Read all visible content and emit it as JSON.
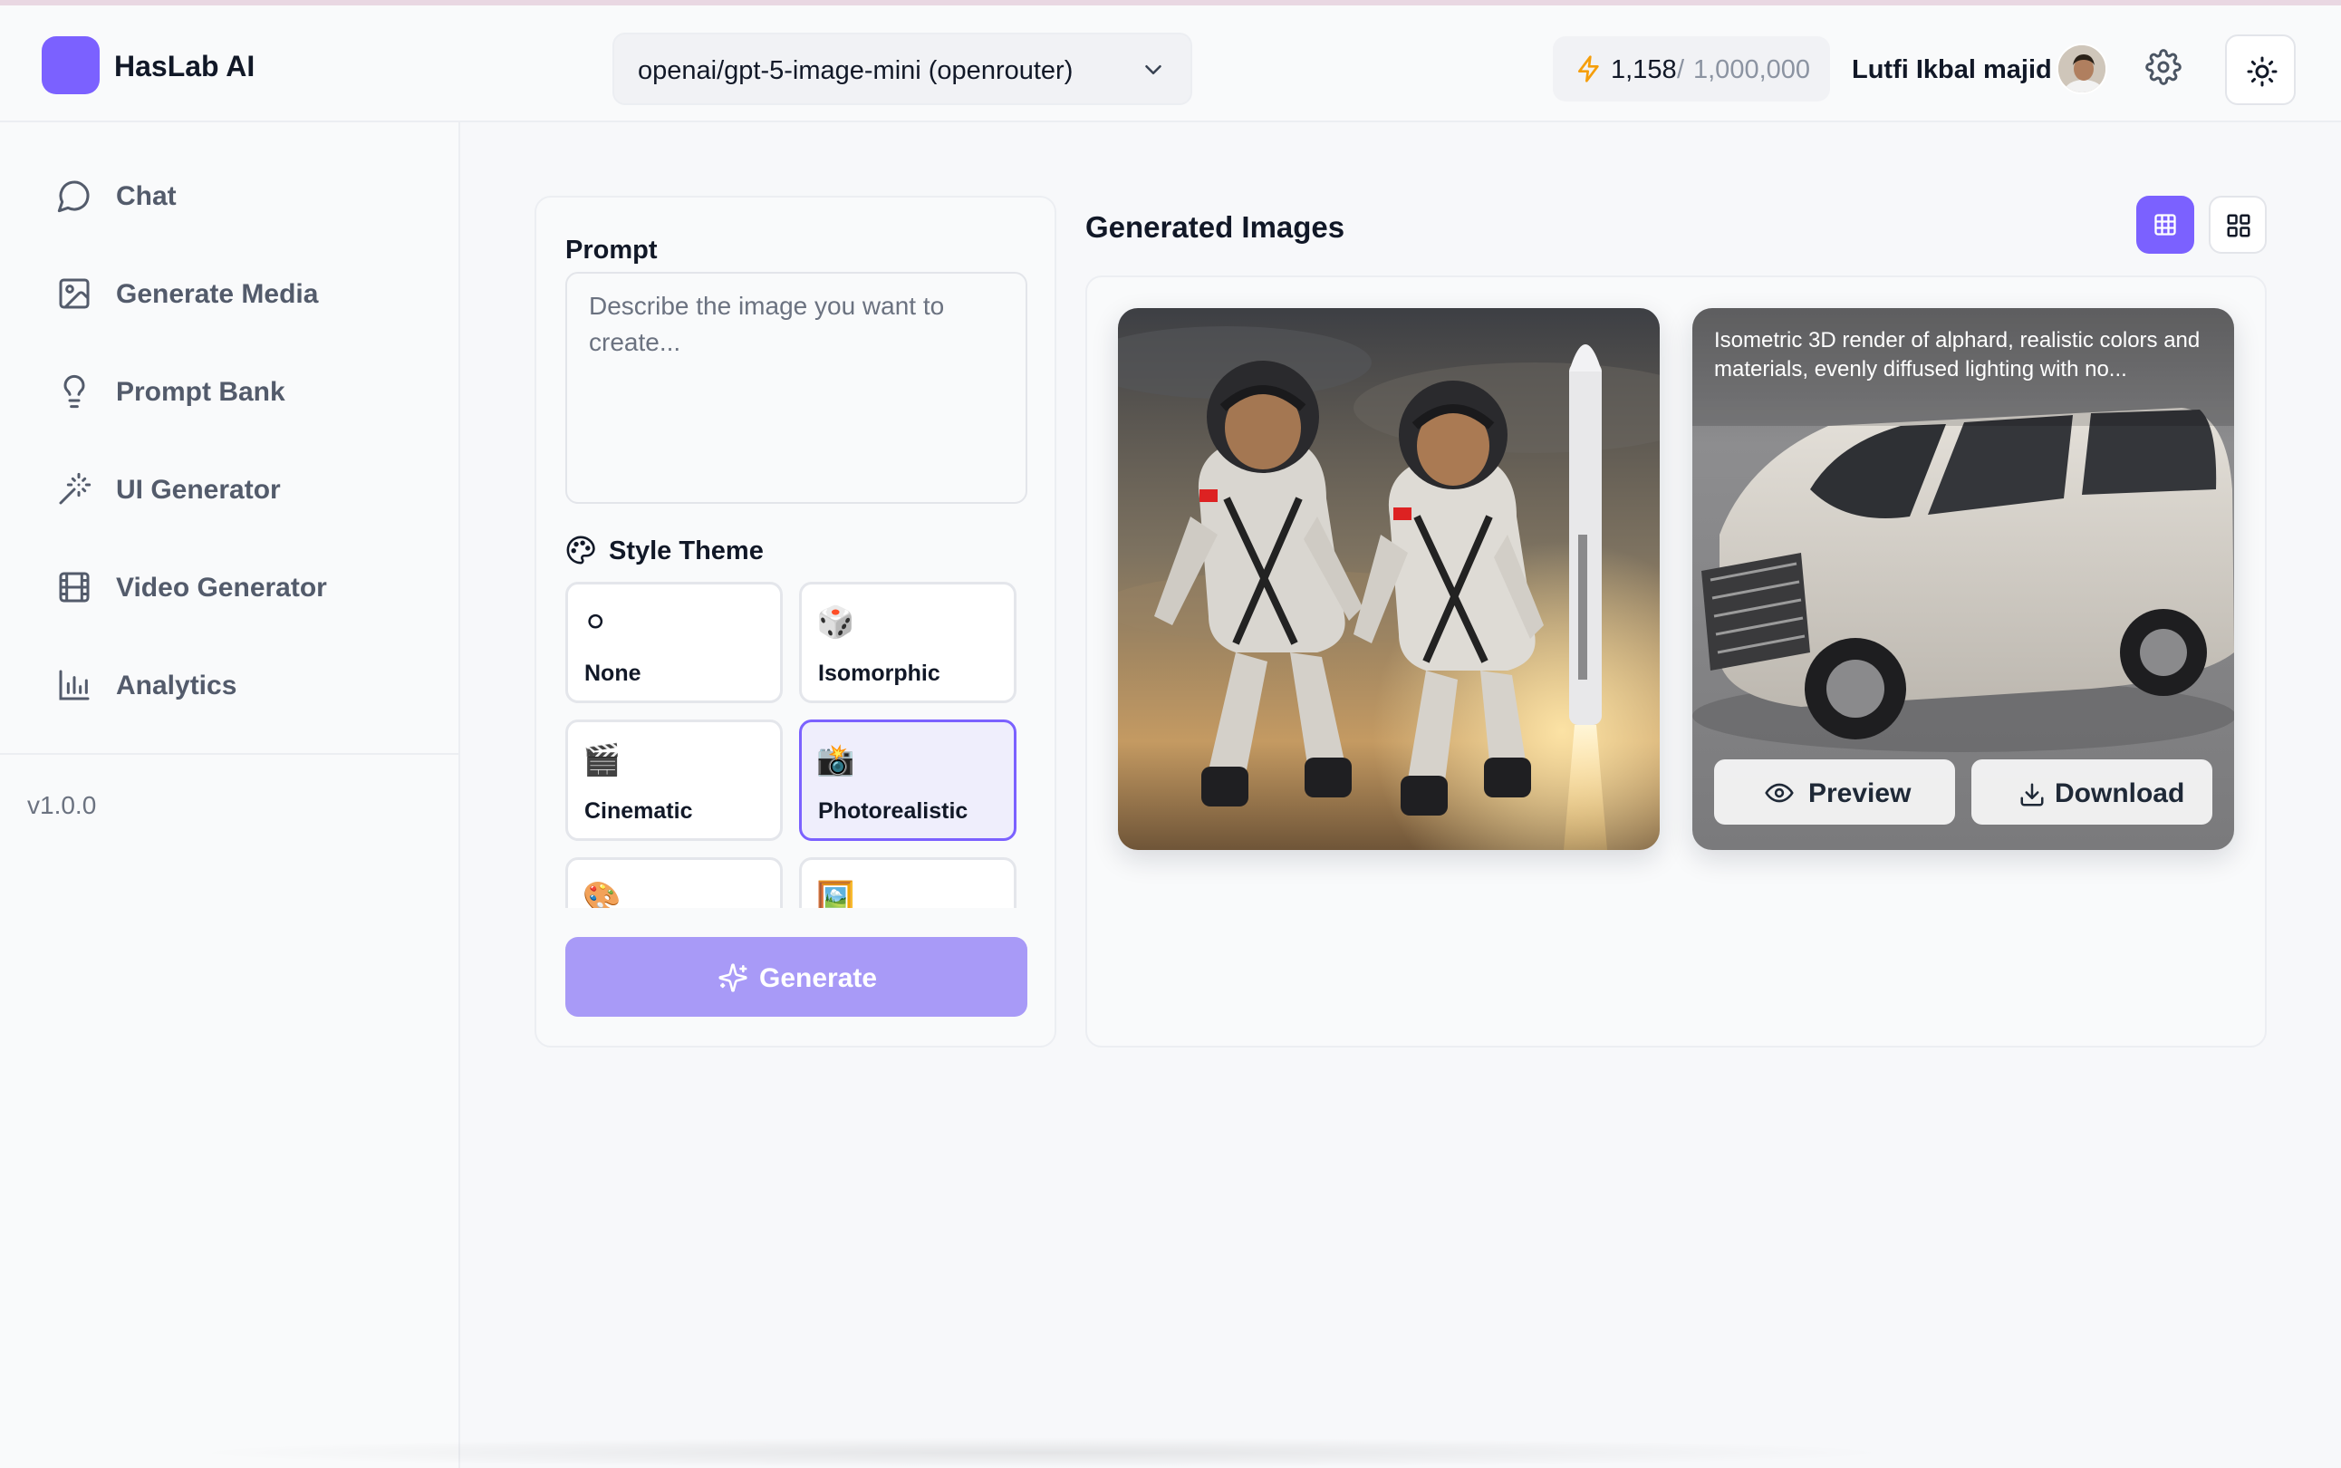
{
  "app": {
    "title": "HasLab AI",
    "brand_color": "#7b61ff"
  },
  "header": {
    "model": {
      "selected": "openai/gpt-5-image-mini (openrouter)"
    },
    "credits": {
      "used": "1,158",
      "separator": "/",
      "limit": "1,000,000",
      "icon": "bolt-icon"
    },
    "user": {
      "name": "Lutfi Ikbal majid"
    },
    "icons": {
      "settings": "gear-icon",
      "theme": "sun-icon"
    }
  },
  "sidebar": {
    "items": [
      {
        "label": "Chat",
        "icon": "chat-bubble-icon"
      },
      {
        "label": "Generate Media",
        "icon": "image-icon"
      },
      {
        "label": "Prompt Bank",
        "icon": "lightbulb-icon"
      },
      {
        "label": "UI Generator",
        "icon": "magic-wand-icon"
      },
      {
        "label": "Video Generator",
        "icon": "film-icon"
      },
      {
        "label": "Analytics",
        "icon": "bar-chart-icon"
      }
    ],
    "version": "v1.0.0"
  },
  "prompt_panel": {
    "label": "Prompt",
    "placeholder": "Describe the image you want to create...",
    "style_theme_label": "Style Theme",
    "styles": [
      {
        "name": "None",
        "emoji": "⚪",
        "selected": false
      },
      {
        "name": "Isomorphic",
        "emoji": "🎲",
        "selected": false
      },
      {
        "name": "Cinematic",
        "emoji": "🎬",
        "selected": false
      },
      {
        "name": "Photorealistic",
        "emoji": "📸",
        "selected": true
      },
      {
        "name": "",
        "emoji": "🎨",
        "selected": false
      },
      {
        "name": "",
        "emoji": "🖼️",
        "selected": false
      }
    ],
    "generate_label": "Generate"
  },
  "results": {
    "title": "Generated Images",
    "view_mode": "grid",
    "images": [
      {
        "subject": "two astronauts jumping beside a launching rocket"
      },
      {
        "subject": "white minivan isometric render",
        "caption": "Isometric 3D render of alphard, realistic colors and materials, evenly diffused lighting with no...",
        "preview_label": "Preview",
        "download_label": "Download"
      }
    ]
  }
}
